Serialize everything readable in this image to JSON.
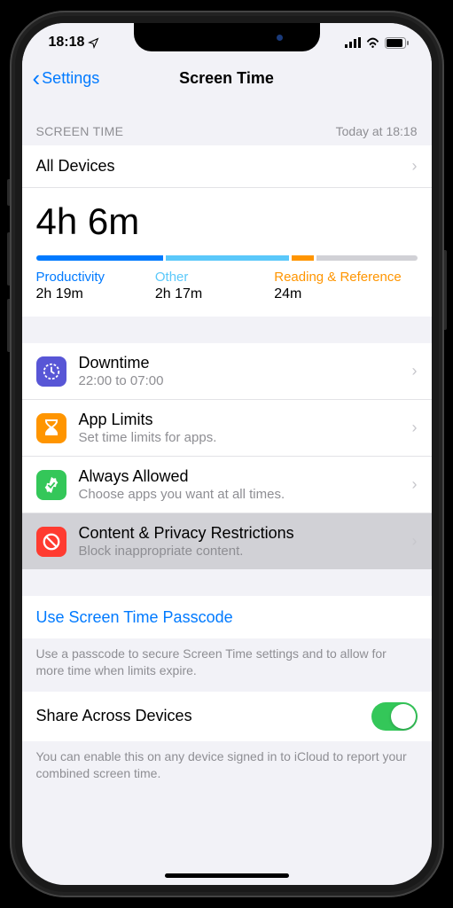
{
  "status": {
    "time": "18:18",
    "signal": 4,
    "wifi": true,
    "battery": 85
  },
  "nav": {
    "back_label": "Settings",
    "title": "Screen Time"
  },
  "summary": {
    "header_left": "Screen Time",
    "header_right": "Today at 18:18",
    "all_devices_label": "All Devices",
    "total_time": "4h 6m",
    "categories": [
      {
        "label": "Productivity",
        "time": "2h 19m",
        "color": "#007aff"
      },
      {
        "label": "Other",
        "time": "2h 17m",
        "color": "#5ac8fa"
      },
      {
        "label": "Reading & Reference",
        "time": "24m",
        "color": "#ff9500"
      }
    ]
  },
  "settings": [
    {
      "title": "Downtime",
      "sub": "22:00 to 07:00",
      "icon": "clock",
      "icon_bg": "#5856d6"
    },
    {
      "title": "App Limits",
      "sub": "Set time limits for apps.",
      "icon": "hourglass",
      "icon_bg": "#ff9500"
    },
    {
      "title": "Always Allowed",
      "sub": "Choose apps you want at all times.",
      "icon": "check-badge",
      "icon_bg": "#34c759"
    },
    {
      "title": "Content & Privacy Restrictions",
      "sub": "Block inappropriate content.",
      "icon": "no-entry",
      "icon_bg": "#ff3b30",
      "selected": true
    }
  ],
  "passcode": {
    "link_label": "Use Screen Time Passcode",
    "footer": "Use a passcode to secure Screen Time settings and to allow for more time when limits expire."
  },
  "share": {
    "label": "Share Across Devices",
    "on": true,
    "footer": "You can enable this on any device signed in to iCloud to report your combined screen time."
  }
}
